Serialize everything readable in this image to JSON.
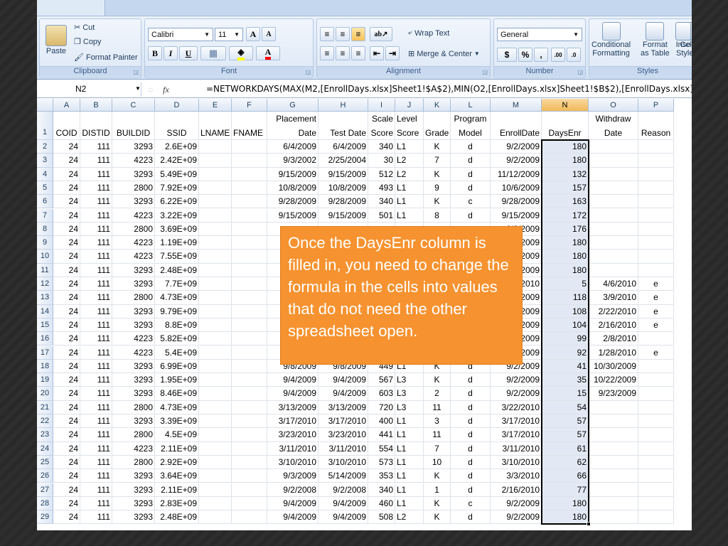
{
  "ribbon": {
    "clipboard": {
      "paste": "Paste",
      "cut": "Cut",
      "copy": "Copy",
      "format_painter": "Format Painter",
      "label": "Clipboard"
    },
    "font": {
      "name": "Calibri",
      "size": "11",
      "grow": "A",
      "shrink": "A",
      "bold": "B",
      "italic": "I",
      "underline": "U",
      "fill_color": "#ffff00",
      "font_color": "#ff0000",
      "label": "Font"
    },
    "alignment": {
      "wrap_text": "Wrap Text",
      "merge_center": "Merge & Center",
      "label": "Alignment"
    },
    "number": {
      "format": "General",
      "currency": "$",
      "percent": "%",
      "comma": ",",
      "inc_decimal": ".00",
      "dec_decimal": ".0",
      "label": "Number"
    },
    "styles": {
      "conditional": "Conditional",
      "conditional2": "Formatting",
      "format_table": "Format",
      "format_table2": "as Table",
      "cell_styles": "Cell",
      "cell_styles2": "Styles",
      "label": "Styles"
    },
    "cells": {
      "insert": "Inse"
    }
  },
  "formula_bar": {
    "name_box": "N2",
    "fx": "fx",
    "formula": "=NETWORKDAYS(MAX(M2,[EnrollDays.xlsx]Sheet1!$A$2),MIN(O2,[EnrollDays.xlsx]Sheet1!$B$2),[EnrollDays.xlsx]S"
  },
  "sheet": {
    "columns": [
      "A",
      "B",
      "C",
      "D",
      "E",
      "F",
      "G",
      "H",
      "I",
      "J",
      "K",
      "L",
      "M",
      "N",
      "O",
      "P"
    ],
    "header_row": {
      "num": "1",
      "cells": [
        {
          "l1": "",
          "l2": "COID"
        },
        {
          "l1": "",
          "l2": "DISTID"
        },
        {
          "l1": "",
          "l2": "BUILDID"
        },
        {
          "l1": "",
          "l2": "SSID"
        },
        {
          "l1": "",
          "l2": "LNAME"
        },
        {
          "l1": "",
          "l2": "FNAME"
        },
        {
          "l1": "Placement",
          "l2": "Date"
        },
        {
          "l1": "",
          "l2": "Test Date"
        },
        {
          "l1": "Scale",
          "l2": "Score"
        },
        {
          "l1": "Level",
          "l2": "Score"
        },
        {
          "l1": "",
          "l2": "Grade"
        },
        {
          "l1": "Program",
          "l2": "Model"
        },
        {
          "l1": "",
          "l2": "EnrollDate"
        },
        {
          "l1": "",
          "l2": "DaysEnr"
        },
        {
          "l1": "Withdraw",
          "l2": "Date"
        },
        {
          "l1": "",
          "l2": "Reason"
        }
      ]
    },
    "rows": [
      [
        "2",
        "24",
        "111",
        "3293",
        "2.6E+09",
        "",
        "",
        "6/4/2009",
        "6/4/2009",
        "340",
        "L1",
        "K",
        "d",
        "9/2/2009",
        "180",
        "",
        ""
      ],
      [
        "3",
        "24",
        "111",
        "4223",
        "2.42E+09",
        "",
        "",
        "9/3/2002",
        "2/25/2004",
        "30",
        "L2",
        "7",
        "d",
        "9/2/2009",
        "180",
        "",
        ""
      ],
      [
        "4",
        "24",
        "111",
        "3293",
        "5.49E+09",
        "",
        "",
        "9/15/2009",
        "9/15/2009",
        "512",
        "L2",
        "K",
        "d",
        "11/12/2009",
        "132",
        "",
        ""
      ],
      [
        "5",
        "24",
        "111",
        "2800",
        "7.92E+09",
        "",
        "",
        "10/8/2009",
        "10/8/2009",
        "493",
        "L1",
        "9",
        "d",
        "10/6/2009",
        "157",
        "",
        ""
      ],
      [
        "6",
        "24",
        "111",
        "3293",
        "6.22E+09",
        "",
        "",
        "9/28/2009",
        "9/28/2009",
        "340",
        "L1",
        "K",
        "c",
        "9/28/2009",
        "163",
        "",
        ""
      ],
      [
        "7",
        "24",
        "111",
        "4223",
        "3.22E+09",
        "",
        "",
        "9/15/2009",
        "9/15/2009",
        "501",
        "L1",
        "8",
        "d",
        "9/15/2009",
        "172",
        "",
        ""
      ],
      [
        "8",
        "24",
        "111",
        "2800",
        "3.69E+09",
        "",
        "",
        "",
        "",
        "",
        "",
        "",
        "",
        "9/9/2009",
        "176",
        "",
        ""
      ],
      [
        "9",
        "24",
        "111",
        "4223",
        "1.19E+09",
        "",
        "",
        "",
        "",
        "",
        "",
        "",
        "",
        "9/2/2009",
        "180",
        "",
        ""
      ],
      [
        "10",
        "24",
        "111",
        "4223",
        "7.55E+09",
        "",
        "",
        "",
        "",
        "",
        "",
        "",
        "",
        "9/2/2009",
        "180",
        "",
        ""
      ],
      [
        "11",
        "24",
        "111",
        "3293",
        "2.48E+09",
        "",
        "",
        "",
        "",
        "",
        "",
        "",
        "",
        "9/2/2009",
        "180",
        "",
        ""
      ],
      [
        "12",
        "24",
        "111",
        "3293",
        "7.7E+09",
        "",
        "",
        "",
        "",
        "",
        "",
        "",
        "",
        "3/24/2010",
        "5",
        "4/6/2010",
        "e"
      ],
      [
        "13",
        "24",
        "111",
        "2800",
        "4.73E+09",
        "",
        "",
        "",
        "",
        "",
        "",
        "",
        "",
        "9/2/2009",
        "118",
        "3/9/2010",
        "e"
      ],
      [
        "14",
        "24",
        "111",
        "3293",
        "9.79E+09",
        "",
        "",
        "",
        "",
        "",
        "",
        "",
        "",
        "9/2/2009",
        "108",
        "2/22/2010",
        "e"
      ],
      [
        "15",
        "24",
        "111",
        "3293",
        "8.8E+09",
        "",
        "",
        "",
        "",
        "",
        "",
        "",
        "",
        "9/2/2009",
        "104",
        "2/16/2010",
        "e"
      ],
      [
        "16",
        "24",
        "111",
        "4223",
        "5.82E+09",
        "",
        "",
        "",
        "",
        "",
        "",
        "",
        "",
        "9/2/2009",
        "99",
        "2/8/2010",
        ""
      ],
      [
        "17",
        "24",
        "111",
        "4223",
        "5.4E+09",
        "",
        "",
        "",
        "",
        "",
        "",
        "",
        "",
        "9/2/2009",
        "92",
        "1/28/2010",
        "e"
      ],
      [
        "18",
        "24",
        "111",
        "3293",
        "6.99E+09",
        "",
        "",
        "9/8/2009",
        "9/8/2009",
        "449",
        "L1",
        "K",
        "d",
        "9/2/2009",
        "41",
        "10/30/2009",
        ""
      ],
      [
        "19",
        "24",
        "111",
        "3293",
        "1.95E+09",
        "",
        "",
        "9/4/2009",
        "9/4/2009",
        "567",
        "L3",
        "K",
        "d",
        "9/2/2009",
        "35",
        "10/22/2009",
        ""
      ],
      [
        "20",
        "24",
        "111",
        "3293",
        "8.46E+09",
        "",
        "",
        "9/4/2009",
        "9/4/2009",
        "603",
        "L3",
        "2",
        "d",
        "9/2/2009",
        "15",
        "9/23/2009",
        ""
      ],
      [
        "21",
        "24",
        "111",
        "2800",
        "4.73E+09",
        "",
        "",
        "3/13/2009",
        "3/13/2009",
        "720",
        "L3",
        "11",
        "d",
        "3/22/2010",
        "54",
        "",
        ""
      ],
      [
        "22",
        "24",
        "111",
        "3293",
        "3.39E+09",
        "",
        "",
        "3/17/2010",
        "3/17/2010",
        "400",
        "L1",
        "3",
        "d",
        "3/17/2010",
        "57",
        "",
        ""
      ],
      [
        "23",
        "24",
        "111",
        "2800",
        "4.5E+09",
        "",
        "",
        "3/23/2010",
        "3/23/2010",
        "441",
        "L1",
        "11",
        "d",
        "3/17/2010",
        "57",
        "",
        ""
      ],
      [
        "24",
        "24",
        "111",
        "4223",
        "2.11E+09",
        "",
        "",
        "3/11/2010",
        "3/11/2010",
        "554",
        "L1",
        "7",
        "d",
        "3/11/2010",
        "61",
        "",
        ""
      ],
      [
        "25",
        "24",
        "111",
        "2800",
        "2.92E+09",
        "",
        "",
        "3/10/2010",
        "3/10/2010",
        "573",
        "L1",
        "10",
        "d",
        "3/10/2010",
        "62",
        "",
        ""
      ],
      [
        "26",
        "24",
        "111",
        "3293",
        "3.64E+09",
        "",
        "",
        "9/3/2009",
        "5/14/2009",
        "353",
        "L1",
        "K",
        "d",
        "3/3/2010",
        "66",
        "",
        ""
      ],
      [
        "27",
        "24",
        "111",
        "3293",
        "2.11E+09",
        "",
        "",
        "9/2/2008",
        "9/2/2008",
        "340",
        "L1",
        "1",
        "d",
        "2/16/2010",
        "77",
        "",
        ""
      ],
      [
        "28",
        "24",
        "111",
        "3293",
        "2.83E+09",
        "",
        "",
        "9/4/2009",
        "9/4/2009",
        "460",
        "L1",
        "K",
        "c",
        "9/2/2009",
        "180",
        "",
        ""
      ],
      [
        "29",
        "24",
        "111",
        "3293",
        "2.48E+09",
        "",
        "",
        "9/4/2009",
        "9/4/2009",
        "508",
        "L2",
        "K",
        "d",
        "9/2/2009",
        "180",
        "",
        ""
      ]
    ]
  },
  "callout": {
    "text": "Once the DaysEnr column is filled in, you need to change the formula in the cells into values that do not need the other spreadsheet open.",
    "color": "#f6922f"
  }
}
